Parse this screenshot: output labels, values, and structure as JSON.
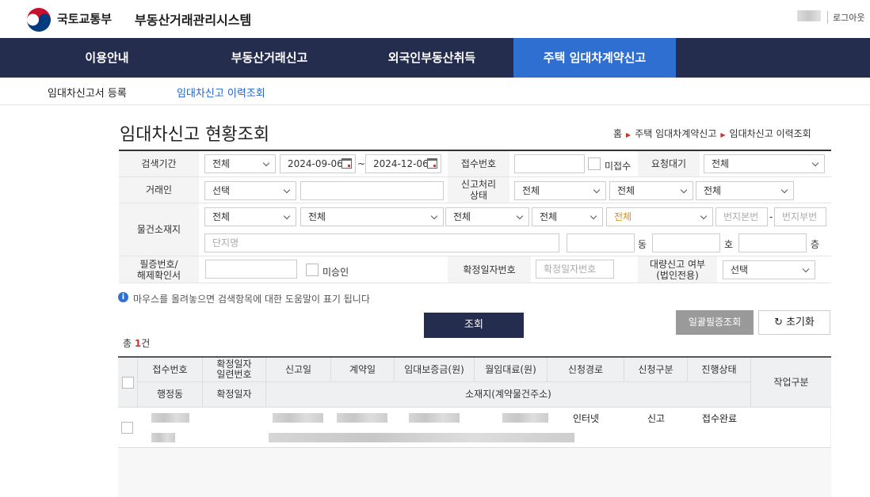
{
  "header": {
    "logo_text": "국토교통부",
    "system_title": "부동산거래관리시스템",
    "logout": "로그아웃"
  },
  "gnb": [
    {
      "label": "이용안내"
    },
    {
      "label": "부동산거래신고"
    },
    {
      "label": "외국인부동산취득"
    },
    {
      "label": "주택 임대차계약신고",
      "active": true
    }
  ],
  "snb": [
    {
      "label": "임대차신고서 등록"
    },
    {
      "label": "임대차신고 이력조회",
      "active": true
    }
  ],
  "page_title": "임대차신고 현황조회",
  "breadcrumb": [
    "홈",
    "주택 임대차계약신고",
    "임대차신고 이력조회"
  ],
  "form": {
    "period_label": "검색기간",
    "period_type": "전체",
    "date_from": "2024-09-06",
    "date_sep": "~",
    "date_to": "2024-12-06",
    "receipt_no_label": "접수번호",
    "unreceived_label": "미접수",
    "request_wait_label": "요청대기",
    "request_wait_value": "전체",
    "party_label": "거래인",
    "party_value": "선택",
    "proc_status_label": "신고처리\n상태",
    "proc_status_1": "전체",
    "proc_status_2": "전체",
    "proc_status_3": "전체",
    "location_label": "물건소재지",
    "loc_1": "전체",
    "loc_2": "전체",
    "loc_3": "전체",
    "loc_4": "전체",
    "loc_5": "전체",
    "main_no_ph": "번지본번",
    "lot_sep": "-",
    "sub_no_ph": "번지부번",
    "complex_ph": "단지명",
    "dong_label": "동",
    "ho_label": "호",
    "floor_label": "층",
    "cert_label": "필증번호/\n해제확인서",
    "unapproved_label": "미승인",
    "fixed_date_no_label": "확정일자번호",
    "fixed_date_no_ph": "확정일자번호",
    "bulk_label": "대량신고 여부\n(법인전용)",
    "bulk_value": "선택"
  },
  "info_text": "마우스를 올려놓으면 검색항목에 대한 도움말이 표기 됩니다",
  "buttons": {
    "search": "조회",
    "bulk_cert": "일괄필증조회",
    "reset": "초기화"
  },
  "total": {
    "prefix": "총 ",
    "count": "1",
    "suffix": "건"
  },
  "table": {
    "headers_top": [
      "접수번호",
      "확정일자\n일련번호",
      "신고일",
      "계약일",
      "임대보증금(원)",
      "월임대료(원)",
      "신청경로",
      "신청구분",
      "진행상태"
    ],
    "headers_bottom": [
      "행정동",
      "확정일자",
      "소재지(계약물건주소)"
    ],
    "work_header": "작업구분",
    "rows": [
      {
        "channel": "인터넷",
        "type": "신고",
        "status": "접수완료"
      }
    ]
  },
  "colors": {
    "nav_bg": "#252d4e",
    "nav_active": "#2e6fd1",
    "accent_red": "#d93030"
  }
}
